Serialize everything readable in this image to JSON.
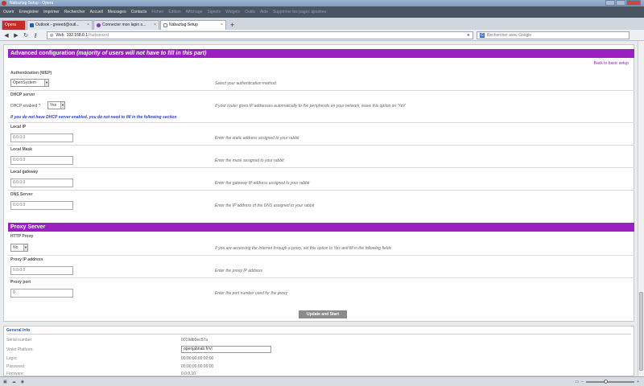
{
  "window": {
    "title": "Nabaztag Setup - Opera"
  },
  "menubar": {
    "items": [
      "Ouvrir",
      "Enregistrer",
      "Imprimer",
      "Rechercher",
      "Accueil",
      "Messages",
      "Contacts"
    ],
    "faint_items": [
      "Fichier",
      "Édition",
      "Affichage",
      "Signets",
      "Widgets",
      "Outils",
      "Aide"
    ],
    "right_text": "Supprimer les pages ajoutées"
  },
  "tabs": [
    {
      "label": "Opera",
      "fav_color": "#ffffff"
    },
    {
      "label": "Outlook - greeed@outl...",
      "fav_color": "#1e5bbf"
    },
    {
      "label": "Connecter mon lapin s...",
      "fav_color": "#7a36c7"
    },
    {
      "label": "Nabaztag Setup",
      "fav_color": "#888888"
    }
  ],
  "address": {
    "web_label": "Web",
    "domain": "192.168.0.1",
    "path": "/#advanced",
    "search_placeholder": "Rechercher avec Google",
    "search_engine": "G"
  },
  "page": {
    "advanced_title": "Advanced configuration",
    "advanced_subtitle": "(majority of users will not have to fill in this part)",
    "back_link": "Back to basic setup",
    "auth": {
      "label": "Authentication (WEP)",
      "value": "OpenSystem",
      "help": "Select your authentication method."
    },
    "dhcp": {
      "label": "DHCP server",
      "field_label": "DHCP enabled ?",
      "value": "Yes",
      "help": "If your router gives IP addresses automatically to the peripherals on your network, leave this option on 'Yes'"
    },
    "dhcp_note": "If you do not have DHCP server enabled, you do not need to fill in the following section",
    "local_ip": {
      "label": "Local IP",
      "value": "0.0.0.0",
      "help": "Enter the static address assigned to your rabbit"
    },
    "local_mask": {
      "label": "Local Mask",
      "value": "0.0.0.0",
      "help": "Enter the mask assigned to your rabbit"
    },
    "local_gateway": {
      "label": "Local gateway",
      "value": "0.0.0.0",
      "help": "Enter the gateway IP address assigned to your rabbit"
    },
    "dns": {
      "label": "DNS Server",
      "value": "0.0.0.0",
      "help": "Enter the IP address of the DNS assigned to your rabbit"
    },
    "proxy_title": "Proxy Server",
    "http_proxy": {
      "label": "HTTP Proxy",
      "value": "No",
      "help": "If you are accessing the Internet through a proxy, set this option to Yes and fill in the following fields"
    },
    "proxy_ip": {
      "label": "Proxy IP address",
      "value": "0.0.0.0",
      "help": "Enter the proxy IP address"
    },
    "proxy_port": {
      "label": "Proxy port",
      "value": "0",
      "help": "Enter the port number used for the proxy"
    },
    "submit": "Update and Start"
  },
  "general_info": {
    "title": "General Info",
    "serial_label": "Serial number:",
    "serial": "0019db9ec57a",
    "violet_label": "Violet Platform:",
    "violet": "openjabnab.fr/vl",
    "login_label": "Login:",
    "login": "00:00:00:00:00:00",
    "password_label": "Password:",
    "password": "00:00:00:00:00:00",
    "firmware_label": "Firmware:",
    "firmware": "0.0.0.10"
  },
  "colors": {
    "accent": "#9b1fc1",
    "link": "#8a1fb3",
    "note": "#2a3fc7"
  }
}
